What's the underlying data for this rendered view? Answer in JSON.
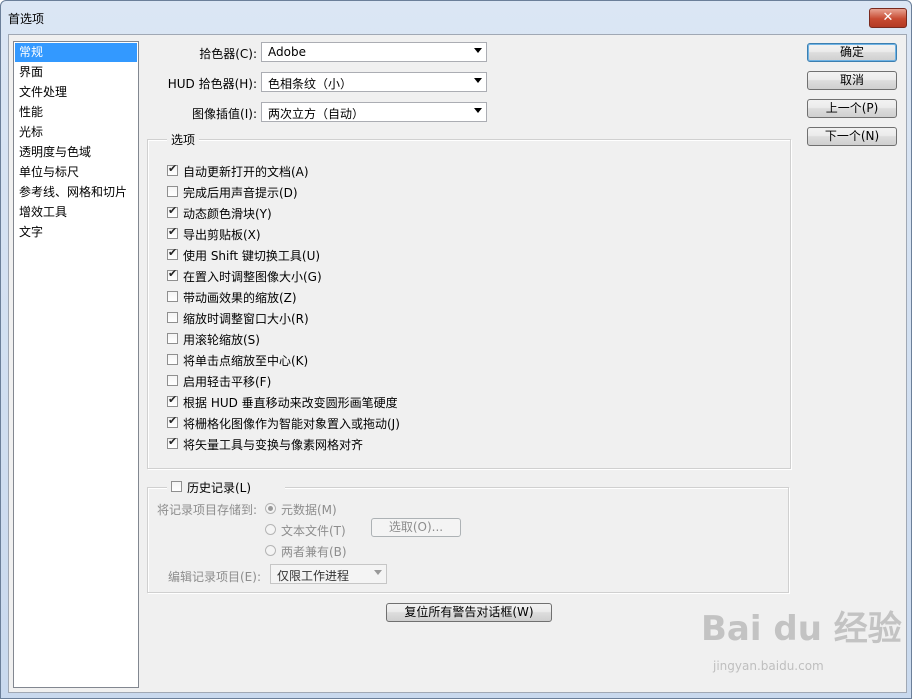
{
  "window": {
    "title": "首选项",
    "close_glyph": "✕"
  },
  "sidebar": {
    "items": [
      {
        "label": "常规",
        "selected": true
      },
      {
        "label": "界面"
      },
      {
        "label": "文件处理"
      },
      {
        "label": "性能"
      },
      {
        "label": "光标"
      },
      {
        "label": "透明度与色域"
      },
      {
        "label": "单位与标尺"
      },
      {
        "label": "参考线、网格和切片"
      },
      {
        "label": "增效工具"
      },
      {
        "label": "文字"
      }
    ]
  },
  "settings": {
    "color_picker": {
      "label": "拾色器(C):",
      "value": "Adobe"
    },
    "hud_color_picker": {
      "label": "HUD 拾色器(H):",
      "value": "色相条纹（小）"
    },
    "image_interpolation": {
      "label": "图像插值(I):",
      "value": "两次立方（自动）"
    }
  },
  "options": {
    "legend": "选项",
    "items": [
      {
        "label": "自动更新打开的文档(A)",
        "checked": true
      },
      {
        "label": "完成后用声音提示(D)",
        "checked": false
      },
      {
        "label": "动态颜色滑块(Y)",
        "checked": true
      },
      {
        "label": "导出剪贴板(X)",
        "checked": true
      },
      {
        "label": "使用 Shift 键切换工具(U)",
        "checked": true
      },
      {
        "label": "在置入时调整图像大小(G)",
        "checked": true
      },
      {
        "label": "带动画效果的缩放(Z)",
        "checked": false
      },
      {
        "label": "缩放时调整窗口大小(R)",
        "checked": false
      },
      {
        "label": "用滚轮缩放(S)",
        "checked": false
      },
      {
        "label": "将单击点缩放至中心(K)",
        "checked": false
      },
      {
        "label": "启用轻击平移(F)",
        "checked": false
      },
      {
        "label": "根据 HUD 垂直移动来改变圆形画笔硬度",
        "checked": true
      },
      {
        "label": "将栅格化图像作为智能对象置入或拖动(J)",
        "checked": true
      },
      {
        "label": "将矢量工具与变换与像素网格对齐",
        "checked": true
      }
    ]
  },
  "history": {
    "legend": "历史记录(L)",
    "checked": false,
    "save_to_label": "将记录项目存储到:",
    "radios": [
      {
        "label": "元数据(M)",
        "selected": true
      },
      {
        "label": "文本文件(T)",
        "selected": false
      },
      {
        "label": "两者兼有(B)",
        "selected": false
      }
    ],
    "choose_button": "选取(O)...",
    "edit_log_label": "编辑记录项目(E):",
    "edit_log_value": "仅限工作进程"
  },
  "reset_warnings_button": "复位所有警告对话框(W)",
  "buttons": {
    "ok": "确定",
    "cancel": "取消",
    "prev": "上一个(P)",
    "next": "下一个(N)"
  },
  "watermark": {
    "brand": "Bai du 经验",
    "url": "jingyan.baidu.com"
  },
  "colors": {
    "selection": "#3399ff",
    "title_gradient_top": "#dbe6f4",
    "close_red": "#c74a31"
  }
}
